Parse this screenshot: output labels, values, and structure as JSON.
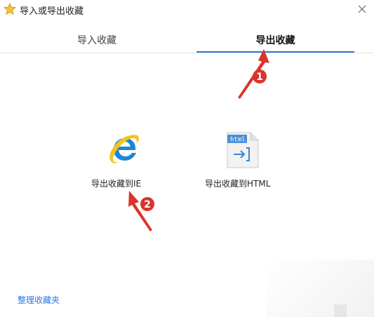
{
  "window": {
    "title": "导入或导出收藏",
    "icons": {
      "app": "star-icon",
      "close": "close-icon"
    }
  },
  "tabs": [
    {
      "label": "导入收藏",
      "active": false
    },
    {
      "label": "导出收藏",
      "active": true
    }
  ],
  "export_options": [
    {
      "label": "导出收藏到IE",
      "icon": "ie-icon"
    },
    {
      "label": "导出收藏到HTML",
      "icon": "html-file-icon",
      "icon_text": "html"
    }
  ],
  "footer": {
    "manage_link": "整理收藏夹"
  },
  "annotations": [
    {
      "number": "1"
    },
    {
      "number": "2"
    }
  ],
  "colors": {
    "accent": "#2b78e4",
    "annotation": "#d9342b",
    "star": "#f2b51d",
    "ie_blue": "#1d86d6",
    "ie_ring": "#f4c41c"
  }
}
